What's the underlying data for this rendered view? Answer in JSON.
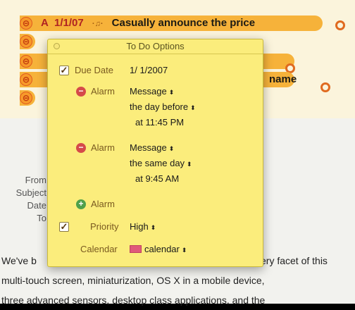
{
  "todos": {
    "first": {
      "priority_mark": "A",
      "date": "1/1/07",
      "bell": "·♫·",
      "title": "Casually announce the price"
    },
    "fourth_partial": "name"
  },
  "headers": {
    "from": "From",
    "subject": "Subject",
    "date": "Date",
    "to": "To"
  },
  "body": {
    "line1_start": "We've b",
    "line1_end": "ery facet of this",
    "line2": "multi-touch screen, miniaturization, OS X in a mobile device,",
    "line3": "three advanced sensors, desktop class applications, and the"
  },
  "popover": {
    "title": "To Do Options",
    "due_date": {
      "label": "Due Date",
      "value": "1/ 1/2007"
    },
    "alarms": [
      {
        "label": "Alarm",
        "type": "Message",
        "when": "the day before",
        "time": "at 11:45 PM"
      },
      {
        "label": "Alarm",
        "type": "Message",
        "when": "the same day",
        "time": "at  9:45 AM"
      }
    ],
    "add_alarm_label": "Alarm",
    "priority": {
      "label": "Priority",
      "value": "High"
    },
    "calendar": {
      "label": "Calendar",
      "value": "calendar"
    },
    "updown_glyph": "⬍",
    "check_glyph": "✓"
  },
  "colors": {
    "todo_highlight": "#f6b23a",
    "popover_bg": "#fbed7c",
    "calendar_swatch": "#e05a7a"
  }
}
